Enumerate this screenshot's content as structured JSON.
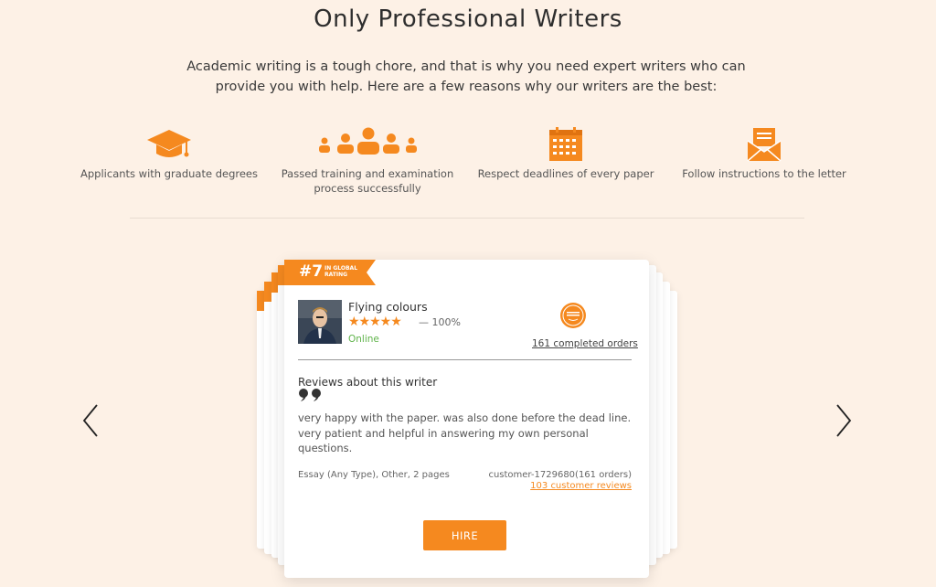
{
  "section": {
    "title": "Only Professional Writers",
    "intro": "Academic writing is a tough chore, and that is why you need expert writers who can provide you with help. Here are a few reasons why our writers are the best:"
  },
  "features": [
    {
      "icon": "graduation-cap-icon",
      "label": "Applicants with graduate degrees"
    },
    {
      "icon": "team-icon",
      "label": "Passed training and examination process successfully"
    },
    {
      "icon": "calendar-icon",
      "label": "Respect deadlines of every paper"
    },
    {
      "icon": "envelope-icon",
      "label": "Follow instructions to the letter"
    }
  ],
  "writer_card": {
    "rank": "#7",
    "rank_caption": "IN GLOBAL RATING",
    "name": "Flying colours",
    "stars": "★★★★★",
    "rating": "— 100%",
    "status": "Online",
    "badge_icon": "reliability-badge-icon",
    "completed_orders": "161 completed orders",
    "reviews_title": "Reviews about this writer",
    "review_text": "very happy with the paper. was also done before the dead line. very patient and helpful in answering my own personal questions.",
    "order_info": "Essay (Any Type), Other, 2 pages",
    "customer": "customer-1729680(161 orders)",
    "customer_reviews": "103 customer reviews",
    "hire_label": "HIRE"
  },
  "colors": {
    "accent": "#f5891f",
    "background": "#fdf1e6",
    "online": "#5fb34a"
  }
}
